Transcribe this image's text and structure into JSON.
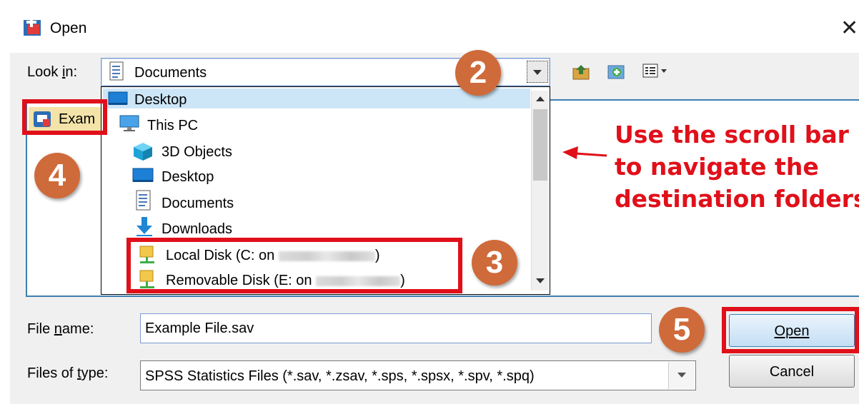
{
  "window": {
    "title": "Open",
    "close_icon": "close-icon"
  },
  "look_in": {
    "label_pre": "Look ",
    "label_u": "i",
    "label_post": "n:",
    "value": "Documents"
  },
  "file_list": {
    "items": [
      {
        "label": "Exam",
        "icon": "spss-data-file-icon"
      }
    ]
  },
  "dropdown": {
    "items": [
      {
        "label": "Desktop",
        "icon": "desktop-icon",
        "indent": 0
      },
      {
        "label": "This PC",
        "icon": "computer-icon",
        "indent": 1
      },
      {
        "label": "3D Objects",
        "icon": "cube-icon",
        "indent": 2
      },
      {
        "label": "Desktop",
        "icon": "desktop-icon",
        "indent": 2
      },
      {
        "label": "Documents",
        "icon": "document-icon",
        "indent": 2
      },
      {
        "label": "Downloads",
        "icon": "download-arrow-icon",
        "indent": 2
      },
      {
        "label": "Local Disk (C: on",
        "icon": "network-drive-icon",
        "indent": 2,
        "suffix": ")"
      },
      {
        "label": "Removable Disk (E: on",
        "icon": "network-drive-icon",
        "indent": 2,
        "suffix": ")"
      }
    ]
  },
  "annotation": {
    "lines": [
      "Use the scroll bar",
      "to navigate the",
      "destination folders"
    ],
    "color": "#e0101a"
  },
  "badges": {
    "b2": "2",
    "b3": "3",
    "b4": "4",
    "b5": "5",
    "color": "#cf6a3a"
  },
  "file_name": {
    "label_pre": "File ",
    "label_u": "n",
    "label_post": "ame:",
    "value": "Example File.sav"
  },
  "file_type": {
    "label_pre": "Files of ",
    "label_u": "t",
    "label_post": "ype:",
    "value": "SPSS Statistics Files (*.sav, *.zsav, *.sps, *.spsx, *.spv, *.spq)"
  },
  "buttons": {
    "open": "Open",
    "cancel": "Cancel"
  }
}
